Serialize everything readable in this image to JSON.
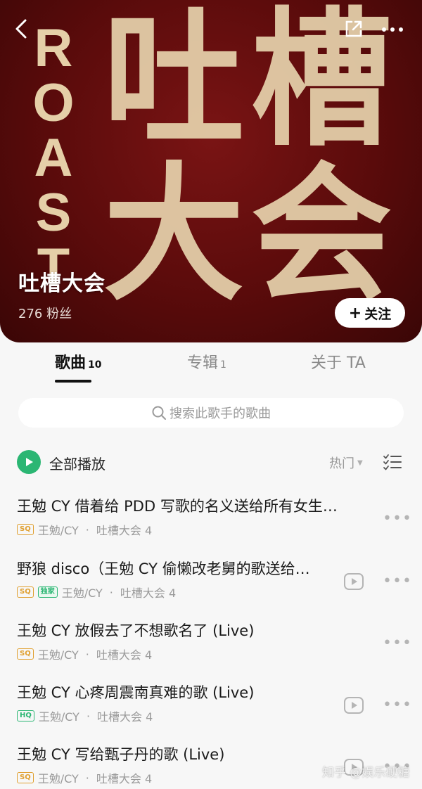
{
  "header": {
    "roast_letters": [
      "R",
      "O",
      "A",
      "S",
      "T"
    ],
    "cover_chars": [
      "吐",
      "槽",
      "大",
      "会"
    ],
    "artist_name": "吐槽大会",
    "fans": "276 粉丝",
    "follow_label": "关注"
  },
  "tabs": [
    {
      "label": "歌曲",
      "count": "10",
      "active": true
    },
    {
      "label": "专辑",
      "count": "1",
      "active": false
    },
    {
      "label": "关于 TA",
      "count": "",
      "active": false
    }
  ],
  "search": {
    "placeholder": "搜索此歌手的歌曲"
  },
  "playall": {
    "label": "全部播放",
    "sort": "热门"
  },
  "songs": [
    {
      "title": "王勉 CY 借着给 PDD 写歌的名义送给所有女生…",
      "badges": [
        "SQ"
      ],
      "artist": "王勉/CY",
      "album": "吐槽大会 4",
      "has_mv": false
    },
    {
      "title": "野狼 disco（王勉 CY 偷懒改老舅的歌送给…",
      "badges": [
        "SQ",
        "独家"
      ],
      "artist": "王勉/CY",
      "album": "吐槽大会 4",
      "has_mv": true
    },
    {
      "title": "王勉 CY 放假去了不想歌名了 (Live)",
      "badges": [
        "SQ"
      ],
      "artist": "王勉/CY",
      "album": "吐槽大会 4",
      "has_mv": false
    },
    {
      "title": "王勉 CY 心疼周震南真难的歌 (Live)",
      "badges": [
        "HQ"
      ],
      "artist": "王勉/CY",
      "album": "吐槽大会 4",
      "has_mv": true
    },
    {
      "title": "王勉 CY 写给甄子丹的歌 (Live)",
      "badges": [
        "SQ"
      ],
      "artist": "王勉/CY",
      "album": "吐槽大会 4",
      "has_mv": true
    }
  ],
  "watermark": "知乎 @娱乐硬糖",
  "colors": {
    "accent": "#2bb673",
    "header_bg": "#5a0b0b",
    "cover_text": "#e7d3ad"
  }
}
